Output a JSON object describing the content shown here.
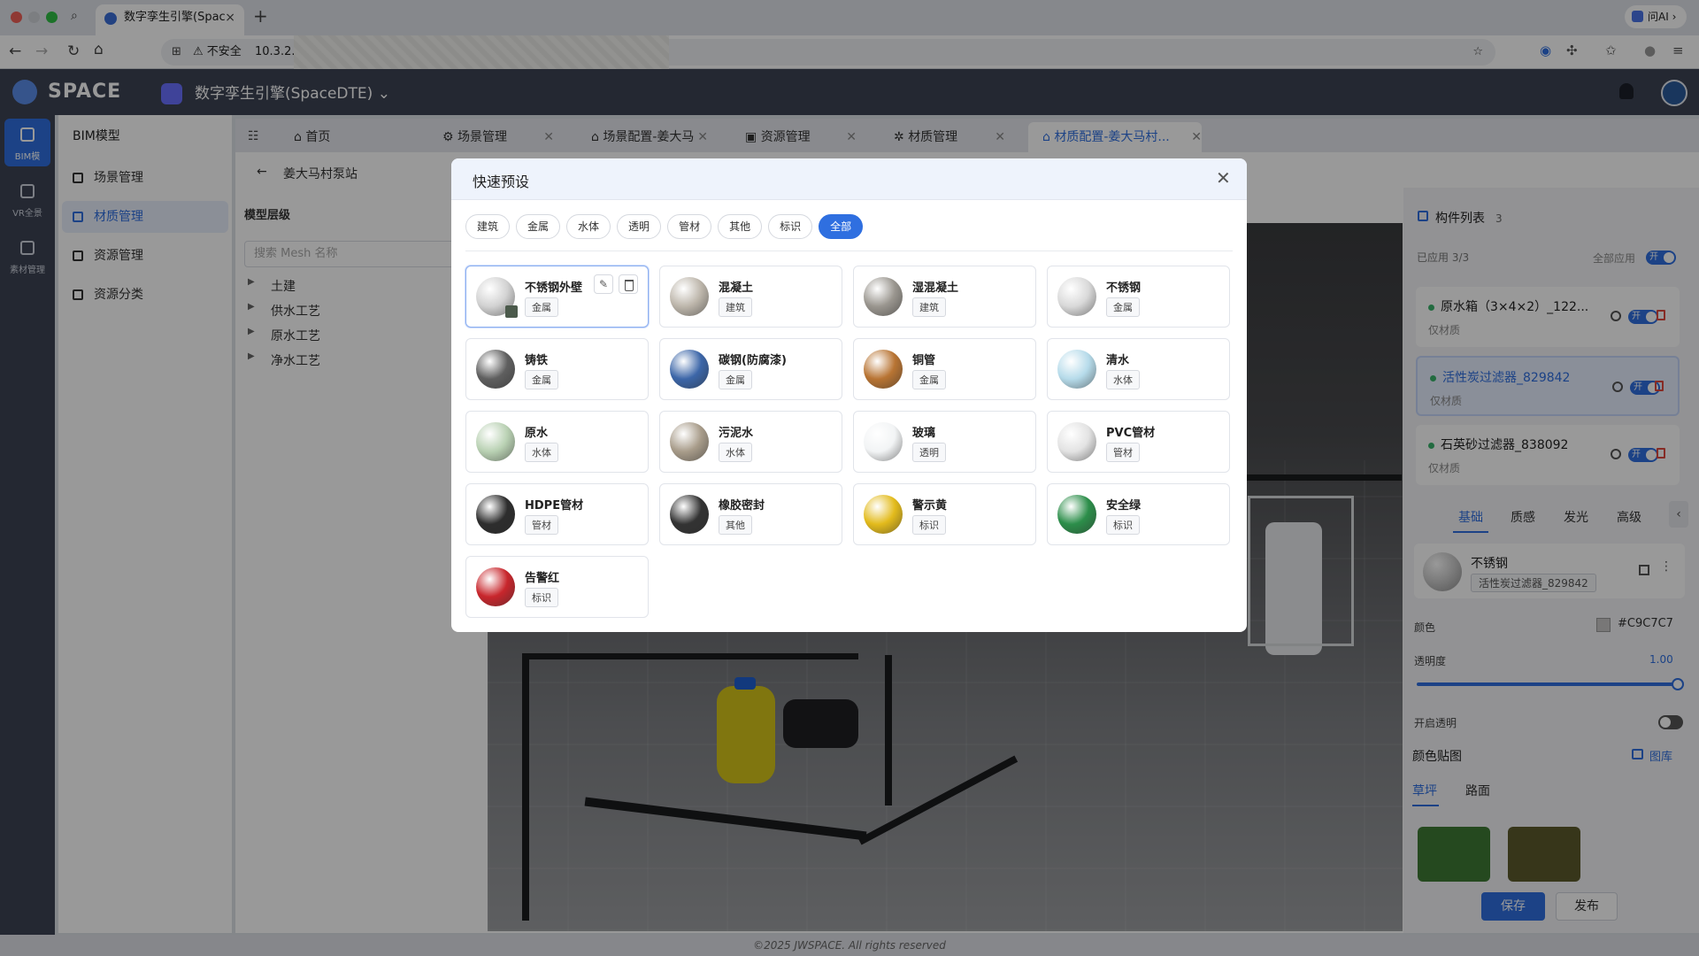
{
  "browser": {
    "tab_title": "数字孪生引擎(Spac",
    "security_label": "不安全",
    "url_host": "10.3.2.",
    "ai_button": "问AI"
  },
  "app": {
    "logo": "SPACE",
    "project": "数字孪生引擎(SpaceDTE)",
    "rail": [
      {
        "label": "BIM模"
      },
      {
        "label": "VR全景"
      },
      {
        "label": "素材管理"
      }
    ],
    "sidebar": {
      "title": "BIM模型",
      "items": [
        {
          "label": "场景管理"
        },
        {
          "label": "材质管理"
        },
        {
          "label": "资源管理"
        },
        {
          "label": "资源分类"
        }
      ]
    },
    "tabs": [
      {
        "label": "首页"
      },
      {
        "label": "场景管理"
      },
      {
        "label": "场景配置-姜大马"
      },
      {
        "label": "资源管理"
      },
      {
        "label": "材质管理"
      },
      {
        "label": "材质配置-姜大马村..."
      }
    ],
    "left": {
      "back_title": "姜大马村泵站",
      "level_title": "模型层级",
      "search_placeholder": "搜索 Mesh 名称",
      "tree": [
        {
          "label": "土建"
        },
        {
          "label": "供水工艺"
        },
        {
          "label": "原水工艺"
        },
        {
          "label": "净水工艺"
        }
      ]
    },
    "right": {
      "title": "构件列表",
      "count": "3",
      "applied": "已应用 3/3",
      "apply_all": "全部应用",
      "toggle_on": "开",
      "components": [
        {
          "name": "原水箱（3×4×2）_122...",
          "sub": "仅材质"
        },
        {
          "name": "活性炭过滤器_829842",
          "sub": "仅材质"
        },
        {
          "name": "石英砂过滤器_838092",
          "sub": "仅材质"
        }
      ],
      "tabs": [
        {
          "label": "基础"
        },
        {
          "label": "质感"
        },
        {
          "label": "发光"
        },
        {
          "label": "高级"
        }
      ],
      "material_name": "不锈钢",
      "material_target": "活性炭过滤器_829842",
      "color_label": "颜色",
      "color_value": "#C9C7C7",
      "opacity_label": "透明度",
      "opacity_value": "1.00",
      "transparent_label": "开启透明",
      "color_tex_label": "颜色贴图",
      "library_label": "图库",
      "tex_tabs": [
        {
          "label": "草坪"
        },
        {
          "label": "路面"
        }
      ],
      "save": "保存",
      "publish": "发布"
    },
    "footer": "©2025 JWSPACE. All rights reserved"
  },
  "modal": {
    "title": "快速预设",
    "chips": [
      {
        "label": "建筑"
      },
      {
        "label": "金属"
      },
      {
        "label": "水体"
      },
      {
        "label": "透明"
      },
      {
        "label": "管材"
      },
      {
        "label": "其他"
      },
      {
        "label": "标识"
      },
      {
        "label": "全部"
      }
    ],
    "presets": [
      {
        "name": "不锈钢外壁",
        "tag": "金属",
        "color": "#d2d2d2"
      },
      {
        "name": "混凝土",
        "tag": "建筑",
        "color": "#bdb6ab"
      },
      {
        "name": "湿混凝土",
        "tag": "建筑",
        "color": "#9a968f"
      },
      {
        "name": "不锈钢",
        "tag": "金属",
        "color": "#d9d9d9"
      },
      {
        "name": "铸铁",
        "tag": "金属",
        "color": "#5f5f5f"
      },
      {
        "name": "碳钢(防腐漆)",
        "tag": "金属",
        "color": "#3c66a8"
      },
      {
        "name": "铜管",
        "tag": "金属",
        "color": "#b87433"
      },
      {
        "name": "清水",
        "tag": "水体",
        "color": "#b6dbea"
      },
      {
        "name": "原水",
        "tag": "水体",
        "color": "#b9d1b3"
      },
      {
        "name": "污泥水",
        "tag": "水体",
        "color": "#a89c8a"
      },
      {
        "name": "玻璃",
        "tag": "透明",
        "color": "#f2f4f5"
      },
      {
        "name": "PVC管材",
        "tag": "管材",
        "color": "#e3e3e3"
      },
      {
        "name": "HDPE管材",
        "tag": "管材",
        "color": "#2d2d2d"
      },
      {
        "name": "橡胶密封",
        "tag": "其他",
        "color": "#333333"
      },
      {
        "name": "警示黄",
        "tag": "标识",
        "color": "#e3bb1c"
      },
      {
        "name": "安全绿",
        "tag": "标识",
        "color": "#2c8e4a"
      },
      {
        "name": "告警红",
        "tag": "标识",
        "color": "#c8262c"
      }
    ]
  },
  "colors": {
    "accent": "#2f6fe0",
    "header": "#3d4354",
    "danger": "#e0483e"
  }
}
